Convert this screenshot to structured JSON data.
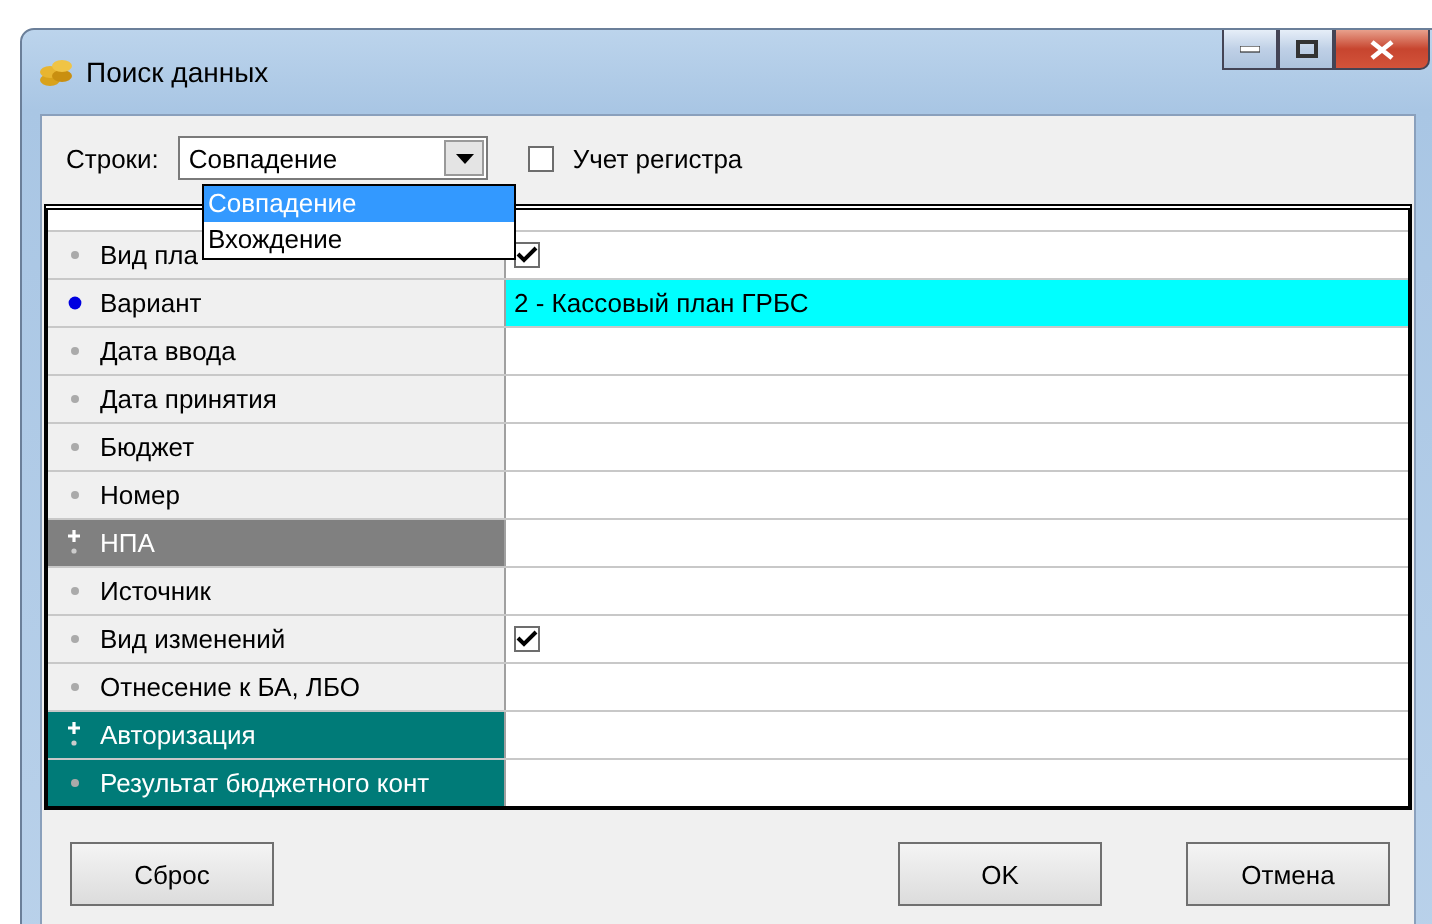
{
  "window": {
    "title": "Поиск данных"
  },
  "toolbar": {
    "label": "Строки:",
    "combo_value": "Совпадение",
    "options": [
      {
        "label": "Совпадение",
        "selected": true
      },
      {
        "label": "Вхождение",
        "selected": false
      }
    ],
    "case_checkbox": {
      "label": "Учет регистра",
      "checked": false
    }
  },
  "rows": [
    {
      "label": "Вид пла",
      "selected": false,
      "expandable": false,
      "checked": true
    },
    {
      "label": "Вариант",
      "selected": true,
      "expandable": false,
      "value": "2 - Кассовый план ГРБС",
      "highlight": true
    },
    {
      "label": "Дата ввода",
      "selected": false,
      "expandable": false
    },
    {
      "label": "Дата принятия",
      "selected": false,
      "expandable": false
    },
    {
      "label": "Бюджет",
      "selected": false,
      "expandable": false
    },
    {
      "label": "Номер",
      "selected": false,
      "expandable": false
    },
    {
      "label": "НПА",
      "selected": false,
      "expandable": true,
      "color": "#808080"
    },
    {
      "label": "Источник",
      "selected": false,
      "expandable": false
    },
    {
      "label": "Вид изменений",
      "selected": false,
      "expandable": false,
      "checked": true
    },
    {
      "label": "Отнесение к БА, ЛБО",
      "selected": false,
      "expandable": false
    },
    {
      "label": "Авторизация",
      "selected": false,
      "expandable": true,
      "color": "#007b78"
    },
    {
      "label": "Результат бюджетного конт",
      "selected": false,
      "expandable": false,
      "color": "#007b78"
    }
  ],
  "buttons": {
    "reset": "Сброс",
    "ok": "OK",
    "cancel": "Отмена"
  }
}
